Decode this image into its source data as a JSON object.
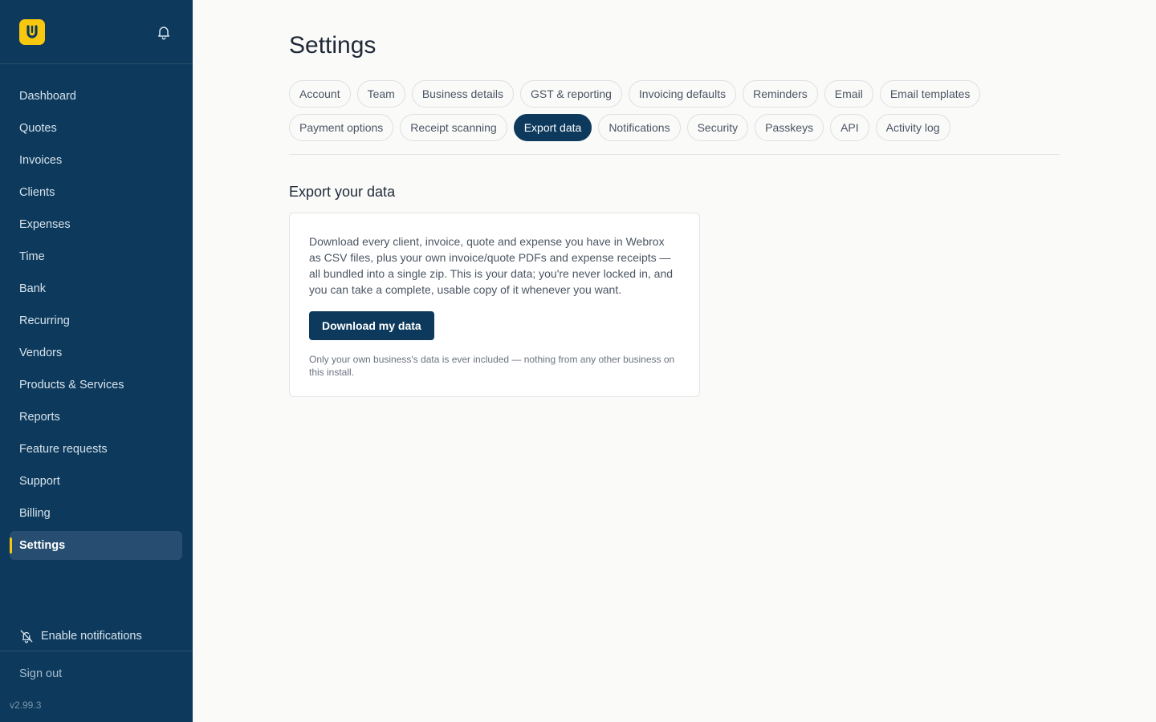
{
  "sidebar": {
    "logo_letter": "U",
    "nav": [
      {
        "label": "Dashboard",
        "active": false
      },
      {
        "label": "Quotes",
        "active": false
      },
      {
        "label": "Invoices",
        "active": false
      },
      {
        "label": "Clients",
        "active": false
      },
      {
        "label": "Expenses",
        "active": false
      },
      {
        "label": "Time",
        "active": false
      },
      {
        "label": "Bank",
        "active": false
      },
      {
        "label": "Recurring",
        "active": false
      },
      {
        "label": "Vendors",
        "active": false
      },
      {
        "label": "Products & Services",
        "active": false
      },
      {
        "label": "Reports",
        "active": false
      },
      {
        "label": "Feature requests",
        "active": false
      },
      {
        "label": "Support",
        "active": false
      },
      {
        "label": "Billing",
        "active": false
      },
      {
        "label": "Settings",
        "active": true
      }
    ],
    "enable_notifications": "Enable notifications",
    "sign_out": "Sign out",
    "version": "v2.99.3"
  },
  "main": {
    "title": "Settings",
    "tab_rows": [
      [
        {
          "label": "Account",
          "active": false
        },
        {
          "label": "Team",
          "active": false
        },
        {
          "label": "Business details",
          "active": false
        },
        {
          "label": "GST & reporting",
          "active": false
        },
        {
          "label": "Invoicing defaults",
          "active": false
        },
        {
          "label": "Reminders",
          "active": false
        },
        {
          "label": "Email",
          "active": false
        },
        {
          "label": "Email templates",
          "active": false
        }
      ],
      [
        {
          "label": "Payment options",
          "active": false
        },
        {
          "label": "Receipt scanning",
          "active": false
        },
        {
          "label": "Export data",
          "active": true
        },
        {
          "label": "Notifications",
          "active": false
        },
        {
          "label": "Security",
          "active": false
        },
        {
          "label": "Passkeys",
          "active": false
        },
        {
          "label": "API",
          "active": false
        },
        {
          "label": "Activity log",
          "active": false
        }
      ]
    ],
    "section_title": "Export your data",
    "card": {
      "description": "Download every client, invoice, quote and expense you have in Webrox as CSV files, plus your own invoice/quote PDFs and expense receipts — all bundled into a single zip. This is your data; you're never locked in, and you can take a complete, usable copy of it whenever you want.",
      "button": "Download my data",
      "note": "Only your own business's data is ever included — nothing from any other business on this install."
    }
  },
  "colors": {
    "sidebar_bg": "#0d3a5c",
    "accent_yellow": "#f9c80e",
    "primary": "#0d3a5c",
    "page_bg": "#fafaf9"
  }
}
